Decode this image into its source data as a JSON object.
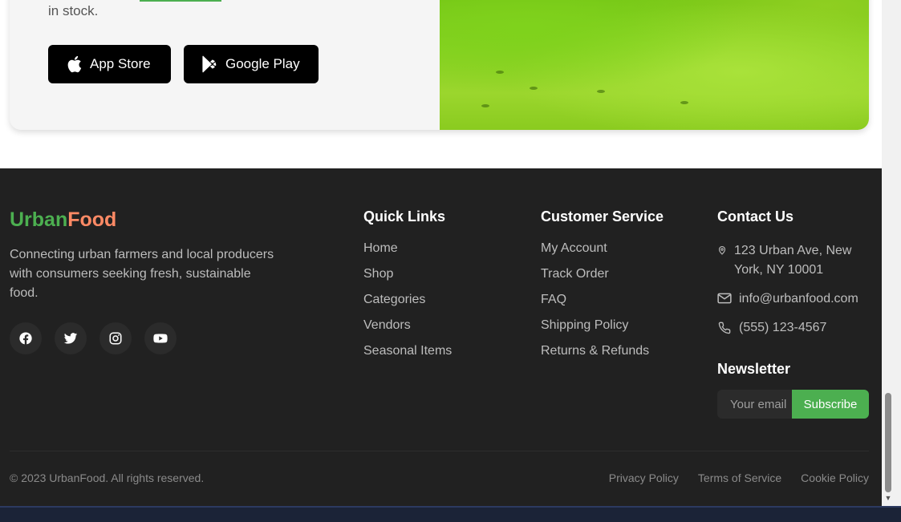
{
  "app_card": {
    "stock_text": "in stock.",
    "app_store_label": "App Store",
    "google_play_label": "Google Play"
  },
  "footer": {
    "brand": {
      "part1": "Urban",
      "part2": "Food"
    },
    "tagline": "Connecting urban farmers and local producers with consumers seeking fresh, sustainable food.",
    "socials": [
      "facebook-icon",
      "twitter-icon",
      "instagram-icon",
      "youtube-icon"
    ],
    "quick_links": {
      "title": "Quick Links",
      "items": [
        "Home",
        "Shop",
        "Categories",
        "Vendors",
        "Seasonal Items"
      ]
    },
    "customer_service": {
      "title": "Customer Service",
      "items": [
        "My Account",
        "Track Order",
        "FAQ",
        "Shipping Policy",
        "Returns & Refunds"
      ]
    },
    "contact": {
      "title": "Contact Us",
      "address": "123 Urban Ave, New York, NY 10001",
      "email": "info@urbanfood.com",
      "phone": "(555) 123-4567"
    },
    "newsletter": {
      "title": "Newsletter",
      "placeholder": "Your email",
      "button": "Subscribe"
    },
    "copyright": "© 2023 UrbanFood. All rights reserved.",
    "legal_links": [
      "Privacy Policy",
      "Terms of Service",
      "Cookie Policy"
    ]
  },
  "colors": {
    "accent_green": "#4caf50",
    "accent_orange": "#ff8a65",
    "footer_bg": "#212121"
  }
}
